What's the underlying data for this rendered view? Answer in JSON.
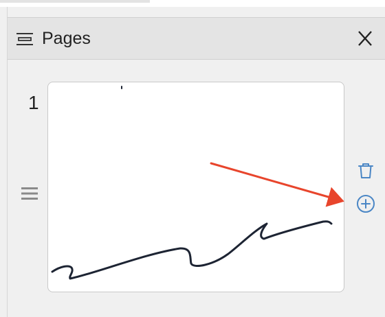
{
  "panel": {
    "title": "Pages",
    "close_label": "X"
  },
  "pages": [
    {
      "number": "1"
    }
  ],
  "colors": {
    "accent": "#4a86c5",
    "annotation_arrow": "#e8452c",
    "ink": "#1d2433"
  },
  "icons": {
    "header": "pages-list-icon",
    "drag": "drag-handle-icon",
    "delete": "trash-icon",
    "add": "add-page-icon"
  }
}
